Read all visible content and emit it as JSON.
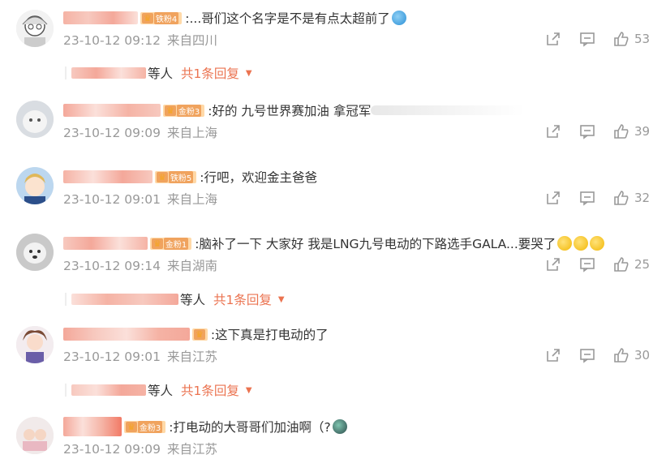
{
  "comments": [
    {
      "badge": "铁粉4",
      "text": ":...哥们这个名字是不是有点太超前了",
      "time": "23-10-12 09:12",
      "location": "来自四川",
      "likes": "53",
      "reply": {
        "dengren": "等人",
        "count": "共1条回复"
      }
    },
    {
      "badge": "金粉3",
      "text": ":好的 九号世界赛加油 拿冠军",
      "time": "23-10-12 09:09",
      "location": "来自上海",
      "likes": "39"
    },
    {
      "badge": "铁粉5",
      "text": ":行吧，欢迎金主爸爸",
      "time": "23-10-12 09:01",
      "location": "来自上海",
      "likes": "32"
    },
    {
      "badge": "金粉1",
      "text": ":脑补了一下 大家好 我是LNG九号电动的下路选手GALA...要哭了",
      "time": "23-10-12 09:14",
      "location": "来自湖南",
      "likes": "25",
      "reply": {
        "dengren": "等人",
        "count": "共1条回复"
      }
    },
    {
      "badge": "",
      "text": ":这下真是打电动的了",
      "time": "23-10-12 09:01",
      "location": "来自江苏",
      "likes": "30",
      "reply": {
        "dengren": "等人",
        "count": "共1条回复"
      }
    },
    {
      "badge": "金粉3",
      "text": ":打电动的大哥哥们加油啊（?",
      "time": "23-10-12 09:09",
      "location": "来自江苏",
      "likes": ""
    }
  ],
  "icons": {
    "share": "share-icon",
    "comment": "comment-icon",
    "like": "like-icon",
    "dropdown": "triangle-down-icon",
    "crown": "crown-icon"
  },
  "colors": {
    "accent": "#eb7350",
    "meta": "#999999",
    "text": "#333333",
    "badge": "#f0a35e"
  }
}
